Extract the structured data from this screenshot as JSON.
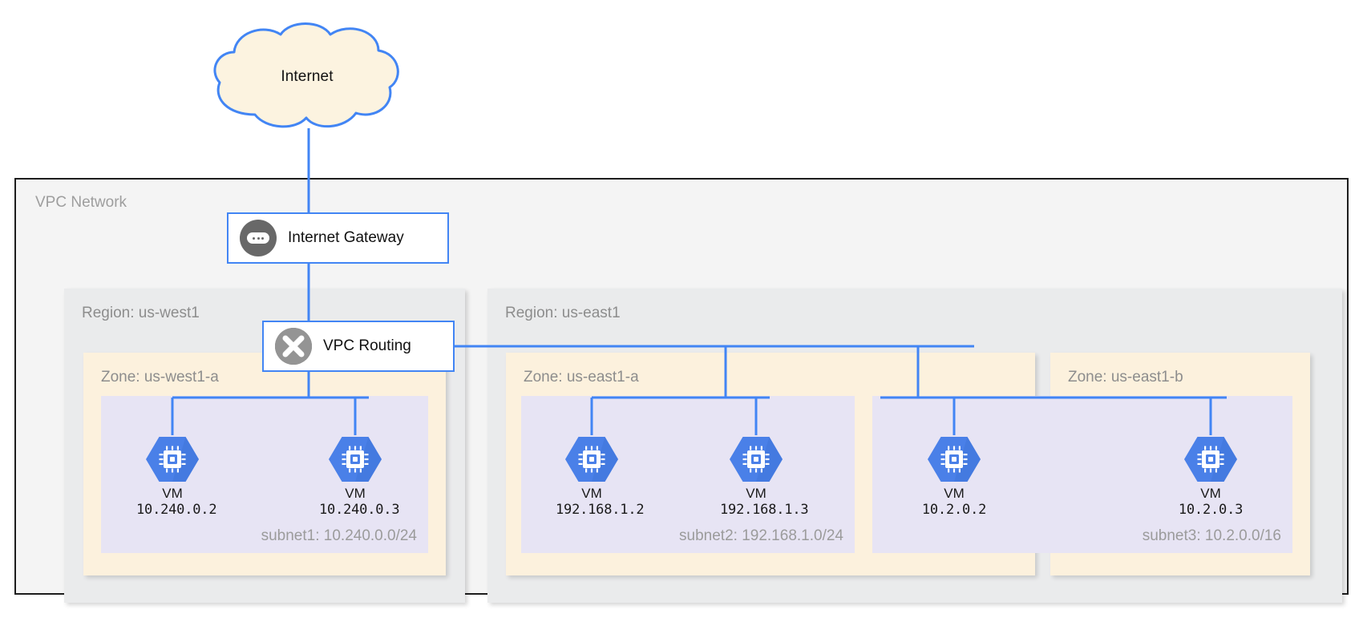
{
  "diagram": {
    "title": "VPC Network",
    "internet": {
      "label": "Internet"
    },
    "gateway": {
      "label": "Internet Gateway",
      "icon": "gateway-icon"
    },
    "routing": {
      "label": "VPC Routing",
      "icon": "router-cross-icon"
    },
    "colors": {
      "wire": "#4285f4",
      "vm_hex": "#4a80e8",
      "cloud_fill": "#fcf3e0",
      "cloud_stroke": "#4285f4",
      "region_fill": "#eaebec",
      "zone_fill": "#fcf1dd",
      "subnet_fill": "#e7e4f4",
      "vpc_fill": "#f4f4f4",
      "vpc_border": "#1d1d1d",
      "node_icon_gray": "#686868",
      "muted_text": "#9b9b9b"
    },
    "regions": [
      {
        "label": "Region: us-west1",
        "zones": [
          {
            "label": "Zone: us-west1-a",
            "subnets": [
              {
                "label": "subnet1:  10.240.0.0/24",
                "vms": [
                  {
                    "name": "VM",
                    "ip": "10.240.0.2"
                  },
                  {
                    "name": "VM",
                    "ip": "10.240.0.3"
                  }
                ]
              }
            ]
          }
        ]
      },
      {
        "label": "Region: us-east1",
        "zones": [
          {
            "label": "Zone: us-east1-a",
            "subnets": [
              {
                "label": "subnet2:  192.168.1.0/24",
                "vms": [
                  {
                    "name": "VM",
                    "ip": "192.168.1.2"
                  },
                  {
                    "name": "VM",
                    "ip": "192.168.1.3"
                  }
                ]
              }
            ]
          },
          {
            "label": "Zone: us-east1-b",
            "subnets": [
              {
                "label": "subnet3:  10.2.0.0/16",
                "vms": [
                  {
                    "name": "VM",
                    "ip": "10.2.0.2"
                  },
                  {
                    "name": "VM",
                    "ip": "10.2.0.3"
                  }
                ]
              }
            ]
          }
        ]
      }
    ]
  }
}
